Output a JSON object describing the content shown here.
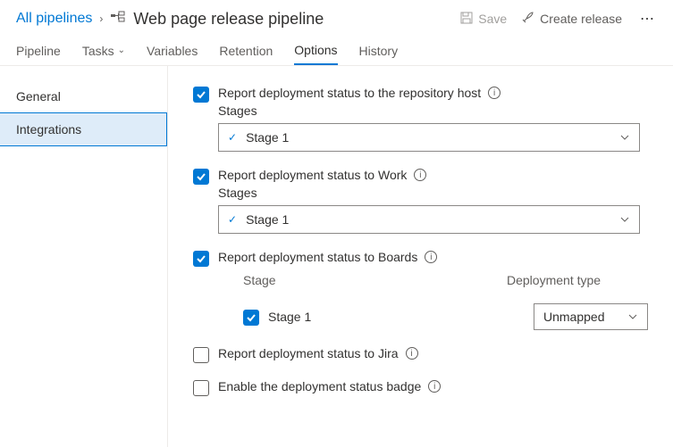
{
  "breadcrumb": {
    "root": "All pipelines"
  },
  "page_title": "Web page release pipeline",
  "header_actions": {
    "save": "Save",
    "create_release": "Create release"
  },
  "tabs": {
    "items": [
      "Pipeline",
      "Tasks",
      "Variables",
      "Retention",
      "Options",
      "History"
    ],
    "selected": "Options"
  },
  "sidebar": {
    "items": [
      "General",
      "Integrations"
    ],
    "selected": "Integrations"
  },
  "options": {
    "repo_host": {
      "label": "Report deployment status to the repository host",
      "stages_label": "Stages",
      "selected_stage": "Stage 1",
      "checked": true
    },
    "work": {
      "label": "Report deployment status to Work",
      "stages_label": "Stages",
      "selected_stage": "Stage 1",
      "checked": true
    },
    "boards": {
      "label": "Report deployment status to Boards",
      "col_stage": "Stage",
      "col_type": "Deployment type",
      "stage_name": "Stage 1",
      "deployment_type": "Unmapped",
      "checked": true
    },
    "jira": {
      "label": "Report deployment status to Jira",
      "checked": false
    },
    "badge": {
      "label": "Enable the deployment status badge",
      "checked": false
    }
  }
}
